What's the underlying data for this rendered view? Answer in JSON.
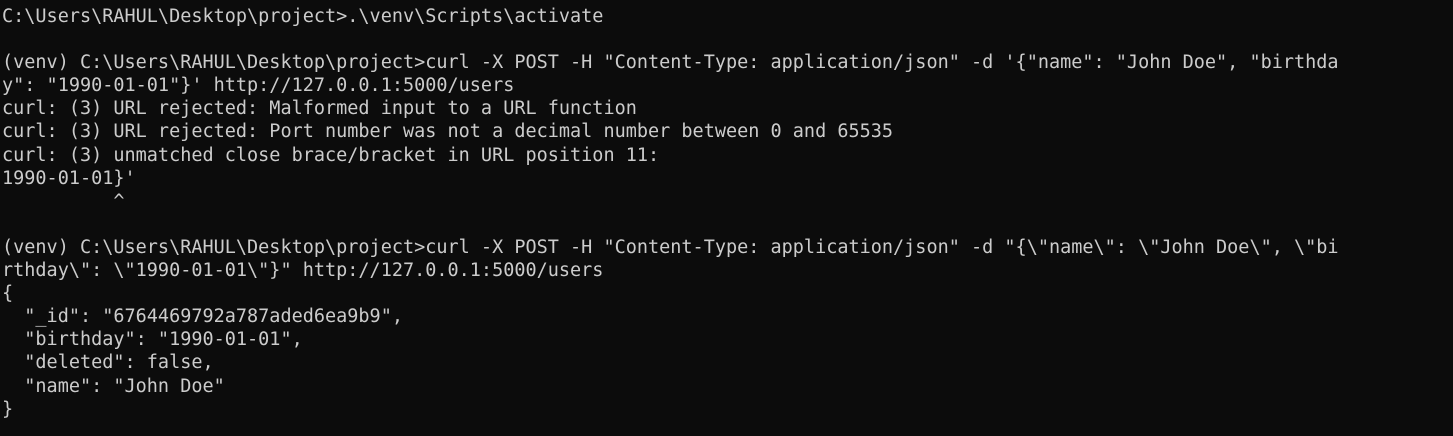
{
  "terminal": {
    "lines": [
      "C:\\Users\\RAHUL\\Desktop\\project>.\\venv\\Scripts\\activate",
      "",
      "(venv) C:\\Users\\RAHUL\\Desktop\\project>curl -X POST -H \"Content-Type: application/json\" -d '{\"name\": \"John Doe\", \"birthda",
      "y\": \"1990-01-01\"}' http://127.0.0.1:5000/users",
      "curl: (3) URL rejected: Malformed input to a URL function",
      "curl: (3) URL rejected: Port number was not a decimal number between 0 and 65535",
      "curl: (3) unmatched close brace/bracket in URL position 11:",
      "1990-01-01}'",
      "          ^",
      "",
      "(venv) C:\\Users\\RAHUL\\Desktop\\project>curl -X POST -H \"Content-Type: application/json\" -d \"{\\\"name\\\": \\\"John Doe\\\", \\\"bi",
      "rthday\\\": \\\"1990-01-01\\\"}\" http://127.0.0.1:5000/users",
      "{",
      "  \"_id\": \"6764469792a787aded6ea9b9\",",
      "  \"birthday\": \"1990-01-01\",",
      "  \"deleted\": false,",
      "  \"name\": \"John Doe\"",
      "}"
    ]
  },
  "colors": {
    "background": "#0c0c0c",
    "foreground": "#cccccc"
  }
}
